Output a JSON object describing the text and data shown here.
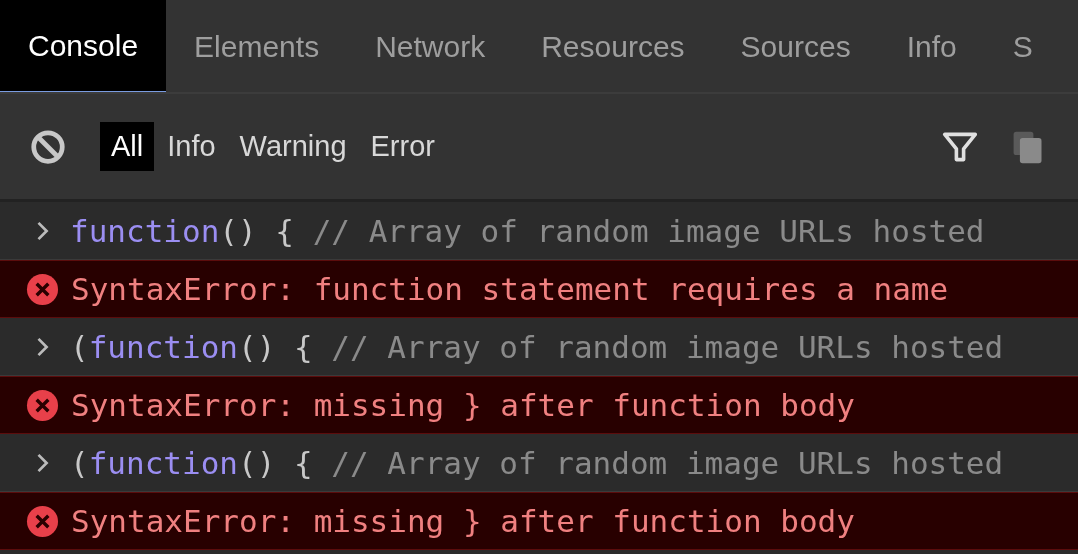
{
  "tabs": [
    {
      "label": "Console",
      "selected": true
    },
    {
      "label": "Elements",
      "selected": false
    },
    {
      "label": "Network",
      "selected": false
    },
    {
      "label": "Resources",
      "selected": false
    },
    {
      "label": "Sources",
      "selected": false
    },
    {
      "label": "Info",
      "selected": false
    },
    {
      "label": "S",
      "selected": false
    }
  ],
  "filters": [
    {
      "label": "All",
      "selected": true
    },
    {
      "label": "Info",
      "selected": false
    },
    {
      "label": "Warning",
      "selected": false
    },
    {
      "label": "Error",
      "selected": false
    }
  ],
  "log": [
    {
      "kind": "input",
      "keyword": "function",
      "code": "() {",
      "comment": "// Array of random image URLs hosted"
    },
    {
      "kind": "error",
      "text": "SyntaxError: function statement requires a name"
    },
    {
      "kind": "input",
      "prefix": "(",
      "keyword": "function",
      "code": "() {",
      "comment": "// Array of random image URLs hosted"
    },
    {
      "kind": "error",
      "text": "SyntaxError: missing } after function body"
    },
    {
      "kind": "input",
      "prefix": "(",
      "keyword": "function",
      "code": "() {",
      "comment": "// Array of random image URLs hosted"
    },
    {
      "kind": "error",
      "text": "SyntaxError: missing } after function body"
    }
  ]
}
